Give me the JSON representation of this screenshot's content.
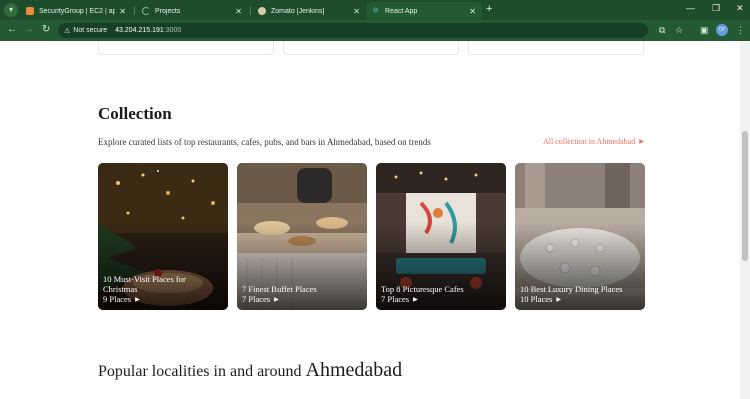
{
  "browser": {
    "tabs": [
      {
        "title": "SecurityGroup | EC2 | ap-south-",
        "icon": "aws-icon",
        "color": "#e88b3a"
      },
      {
        "title": "Projects",
        "icon": "loading-spinner-icon",
        "color": "#7fb5a3"
      },
      {
        "title": "Zomato [Jenkins]",
        "icon": "jenkins-icon",
        "color": "#d9c9a6"
      },
      {
        "title": "React App",
        "icon": "react-icon",
        "color": "#61dafb"
      }
    ],
    "security_label": "Not secure",
    "url_host": "43.204.215.191",
    "url_port": ":3000",
    "avatar_initials": "CP"
  },
  "collection": {
    "title": "Collection",
    "subtitle": "Explore curated lists of top restaurants, cafes, pubs, and bars in Ahmedabad, based on trends",
    "all_link": "All collection in Ahmedabad",
    "cards": [
      {
        "title": "10 Must-Visit Places for Christmas",
        "places": "9 Places"
      },
      {
        "title": "7 Finest Buffet Places",
        "places": "7 Places"
      },
      {
        "title": "Top 8 Picturesque Cafes",
        "places": "7 Places"
      },
      {
        "title": "10 Best Luxury Dining Places",
        "places": "10 Places"
      }
    ]
  },
  "localities": {
    "title_prefix": "Popular localities in and around",
    "city": "Ahmedabad"
  },
  "colors": {
    "chrome": "#1e4d2b",
    "accent_link": "#ef6f5e"
  }
}
